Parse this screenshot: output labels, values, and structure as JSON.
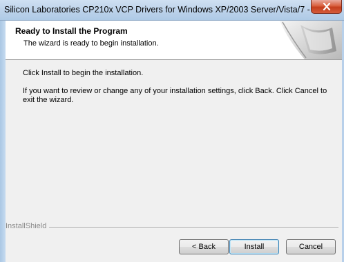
{
  "window": {
    "title": "Silicon Laboratories CP210x VCP Drivers for Windows XP/2003 Server/Vista/7 - Inst...",
    "close_icon": "close-x-icon"
  },
  "header": {
    "title": "Ready to Install the Program",
    "subtitle": "The wizard is ready to begin installation.",
    "graphic_icon": "computer-graphic-icon"
  },
  "content": {
    "line1": "Click Install to begin the installation.",
    "line2": "If you want to review or change any of your installation settings, click Back. Click Cancel to exit the wizard."
  },
  "footer": {
    "brand": "InstallShield",
    "back_label": "< Back",
    "install_label": "Install",
    "cancel_label": "Cancel"
  }
}
